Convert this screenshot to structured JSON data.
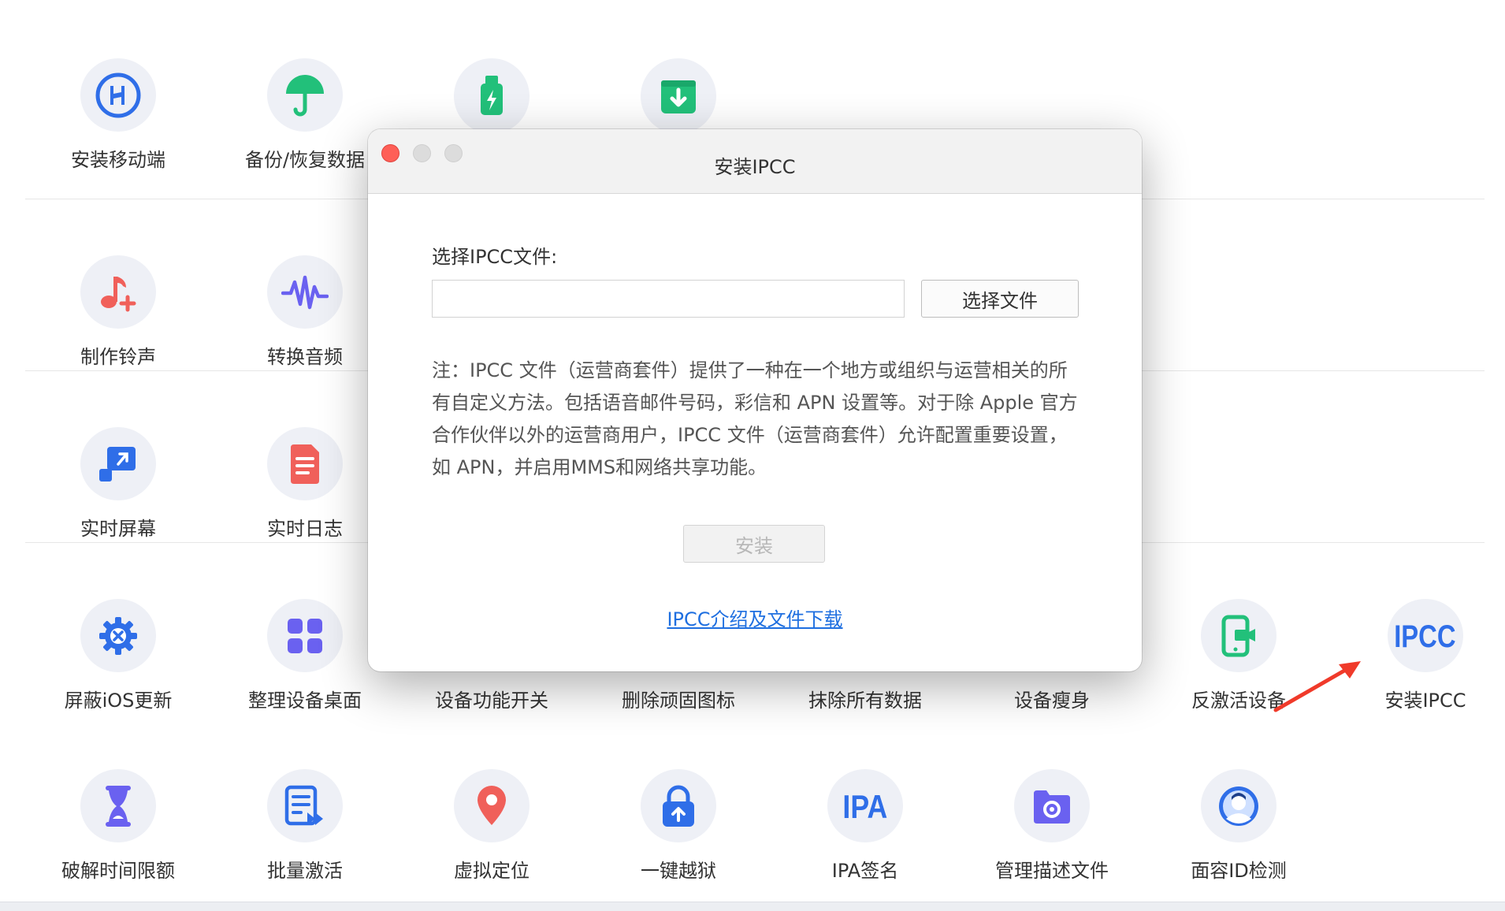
{
  "tools": {
    "row1": [
      {
        "label": "安装移动端",
        "icon": "install-mobile-icon"
      },
      {
        "label": "备份/恢复数据",
        "icon": "umbrella-icon"
      },
      {
        "label": "",
        "icon": "usb-drive-icon"
      },
      {
        "label": "",
        "icon": "download-box-icon"
      }
    ],
    "row2": [
      {
        "label": "制作铃声",
        "icon": "music-note-plus-icon"
      },
      {
        "label": "转换音频",
        "icon": "waveform-icon"
      }
    ],
    "row3": [
      {
        "label": "实时屏幕",
        "icon": "screen-share-icon"
      },
      {
        "label": "实时日志",
        "icon": "log-document-icon"
      }
    ],
    "row4": [
      {
        "label": "屏蔽iOS更新",
        "icon": "gear-x-icon"
      },
      {
        "label": "整理设备桌面",
        "icon": "grid-apps-icon"
      },
      {
        "label": "设备功能开关",
        "icon": ""
      },
      {
        "label": "删除顽固图标",
        "icon": ""
      },
      {
        "label": "抹除所有数据",
        "icon": ""
      },
      {
        "label": "设备瘦身",
        "icon": ""
      },
      {
        "label": "反激活设备",
        "icon": "phone-camera-icon"
      },
      {
        "label": "安装IPCC",
        "icon": "ipcc-text-icon",
        "icon_text": "IPCC"
      }
    ],
    "row5": [
      {
        "label": "破解时间限额",
        "icon": "hourglass-icon"
      },
      {
        "label": "批量激活",
        "icon": "batch-list-icon"
      },
      {
        "label": "虚拟定位",
        "icon": "location-pin-icon"
      },
      {
        "label": "一键越狱",
        "icon": "unlock-icon"
      },
      {
        "label": "IPA签名",
        "icon": "ipa-text-icon",
        "icon_text": "IPA"
      },
      {
        "label": "管理描述文件",
        "icon": "folder-gear-icon"
      },
      {
        "label": "面容ID检测",
        "icon": "face-id-icon"
      }
    ]
  },
  "dialog": {
    "title": "安装IPCC",
    "field_label": "选择IPCC文件:",
    "file_input_value": "",
    "choose_button": "选择文件",
    "note_lines": [
      "注：IPCC 文件（运营商套件）提供了一种在一个地方或组织与运营相关的所",
      "有自定义方法。包括语音邮件号码，彩信和 APN 设置等。对于除 Apple 官方",
      "合作伙伴以外的运营商用户，IPCC 文件（运营商套件）允许配置重要设置，",
      "如 APN，并启用MMS和网络共享功能。"
    ],
    "install_button": "安装",
    "link_text": "IPCC介绍及文件下载"
  },
  "colors": {
    "accent_blue": "#2f6ee8",
    "green": "#22c07a",
    "red": "#f0605a",
    "purple": "#6a61f0",
    "link": "#1f6fe0",
    "arrow": "#f03a2a"
  }
}
